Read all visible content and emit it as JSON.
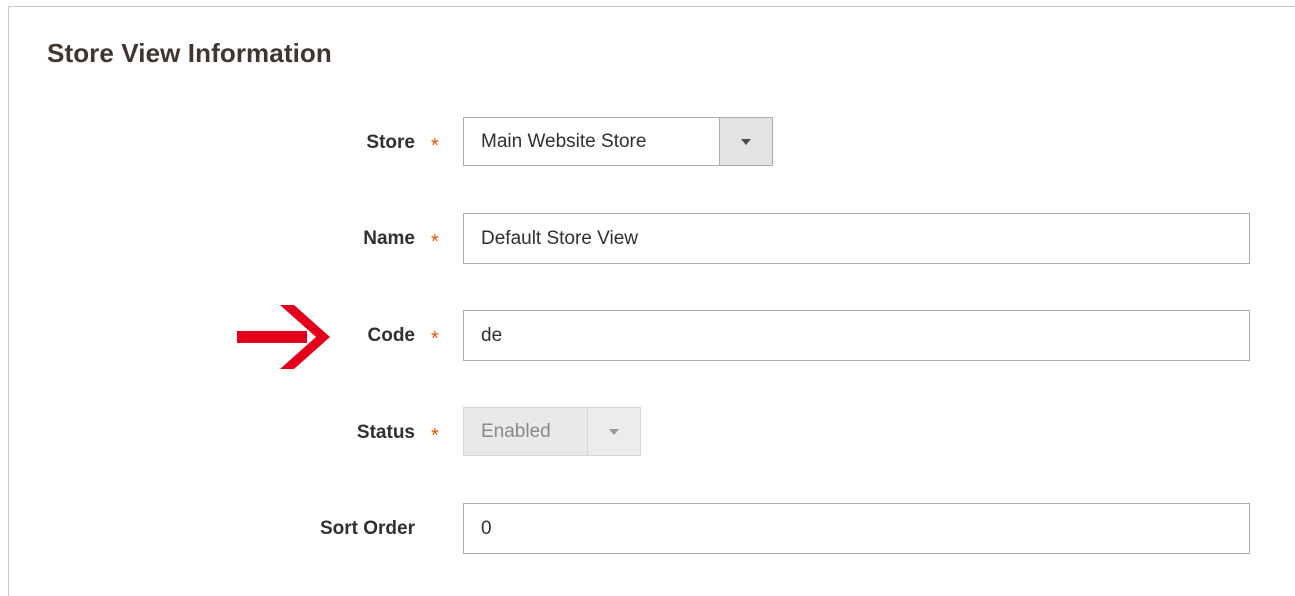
{
  "section": {
    "title": "Store View Information"
  },
  "fields": {
    "store": {
      "label": "Store",
      "required_mark": "*",
      "value": "Main Website Store"
    },
    "name": {
      "label": "Name",
      "required_mark": "*",
      "value": "Default Store View"
    },
    "code": {
      "label": "Code",
      "required_mark": "*",
      "value": "de"
    },
    "status": {
      "label": "Status",
      "required_mark": "*",
      "value": "Enabled"
    },
    "sort_order": {
      "label": "Sort Order",
      "value": "0"
    }
  },
  "icons": {
    "dropdown": "chevron-down-icon",
    "annotation": "red-arrow-icon"
  },
  "colors": {
    "required": "#eb5202",
    "annotation_arrow": "#e2001a"
  }
}
